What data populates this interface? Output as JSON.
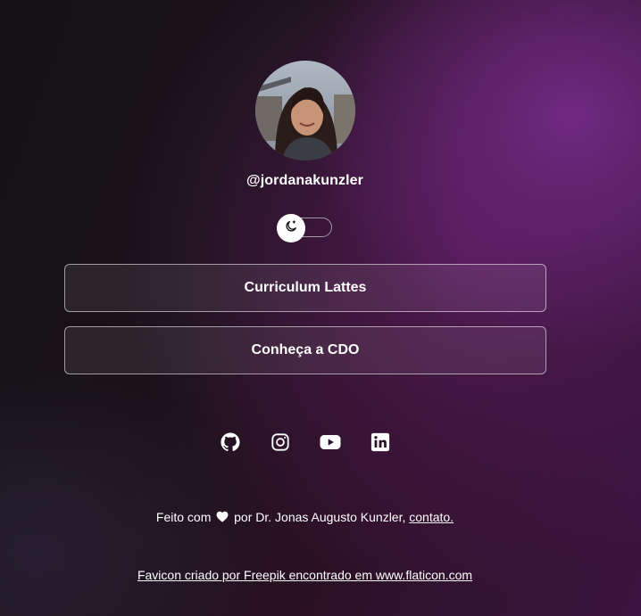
{
  "profile": {
    "username": "@jordanakunzler",
    "avatar_alt": "profile photo"
  },
  "theme_toggle": {
    "icon": "moon-icon",
    "state": "off"
  },
  "links": [
    {
      "label": "Curriculum Lattes"
    },
    {
      "label": "Conheça a CDO"
    }
  ],
  "socials": [
    {
      "icon": "github-icon"
    },
    {
      "icon": "instagram-icon"
    },
    {
      "icon": "youtube-icon"
    },
    {
      "icon": "linkedin-icon"
    }
  ],
  "footer": {
    "made_with_prefix": "Feito com",
    "made_with_suffix": "por Dr. Jonas Augusto Kunzler,",
    "contact_link": "contato.",
    "favicon_credit": "Favicon criado por Freepik encontrado em www.flaticon.com"
  },
  "colors": {
    "text": "#ffffff",
    "accent_purple": "#6a2a78"
  }
}
